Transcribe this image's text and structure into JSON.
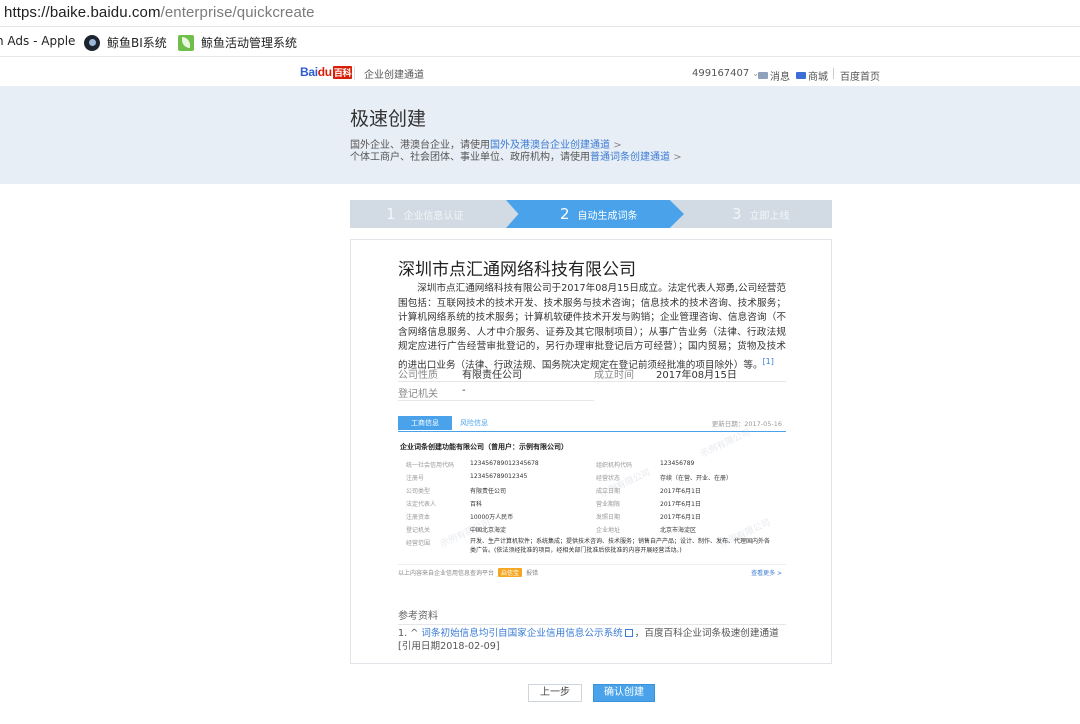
{
  "browser": {
    "url_host": "https://baike.baidu.com",
    "url_path": "/enterprise/quickcreate",
    "bookmarks": [
      {
        "label": "n Ads - Apple"
      },
      {
        "label": "鲸鱼BI系统"
      },
      {
        "label": "鲸鱼活动管理系统"
      }
    ]
  },
  "header": {
    "logo_bai": "Bai",
    "logo_du": "du",
    "logo_baike": "百科",
    "channel": "企业创建通道",
    "user": "499167407",
    "messages": "消息",
    "mall": "商城",
    "home": "百度首页"
  },
  "banner": {
    "title": "极速创建",
    "notice1_prefix": "国外企业、港澳台企业，请使用",
    "notice1_link": "国外及港澳台企业创建通道",
    "notice2_prefix": "个体工商户、社会团体、事业单位、政府机构，请使用",
    "notice2_link": "普通词条创建通道",
    "arrow": ">"
  },
  "steps": [
    {
      "num": "1",
      "label": "企业信息认证"
    },
    {
      "num": "2",
      "label": "自动生成词条"
    },
    {
      "num": "3",
      "label": "立即上线"
    }
  ],
  "card": {
    "company_name": "深圳市点汇通网络科技有限公司",
    "description": "深圳市点汇通网络科技有限公司于2017年08月15日成立。法定代表人郑勇,公司经营范围包括：互联网技术的技术开发、技术服务与技术咨询；信息技术的技术咨询、技术服务；计算机网络系统的技术服务；计算机软硬件技术开发与购销；企业管理咨询、信息咨询（不含网络信息服务、人才中介服务、证券及其它限制项目）；从事广告业务（法律、行政法规规定应进行广告经营审批登记的，另行办理审批登记后方可经营）；国内贸易；货物及技术的进出口业务（法律、行政法规、国务院决定规定在登记前须经批准的项目除外）等。",
    "desc_ref": "[1]",
    "company_type_label": "公司性质",
    "company_type": "有限责任公司",
    "founded_label": "成立时间",
    "founded": "2017年08月15日",
    "authority_label": "登记机关",
    "authority": "-"
  },
  "embed": {
    "tab_active": "工商信息",
    "tab_inactive": "风险信息",
    "updated": "更新日期：2017-05-16",
    "entity": "企业词条创建功能有限公司（曾用户：示例有限公司）",
    "left_labels": [
      "统一社会信用代码",
      "注册号",
      "公司类型",
      "法定代表人",
      "注册资本",
      "登记机关",
      "经营范围"
    ],
    "left_values": [
      "123456789012345678",
      "123456789012345",
      "有限责任公司",
      "百科",
      "10000万人民币",
      "中国北京海淀"
    ],
    "right_labels": [
      "组织机构代码",
      "经营状态",
      "成立日期",
      "营业期限",
      "发照日期",
      "企业地址"
    ],
    "right_values": [
      "123456789",
      "存续（在营、开业、在册）",
      "2017年6月1日",
      "2017年6月1日",
      "2017年6月1日",
      "北京市海淀区"
    ],
    "scope": "开发、生产计算机软件；系统集成；提供技术咨询、技术服务；销售自产产品；设计、制作、发布、代理国内外各类广告。(依法须经批准的项目，经相关部门批准后依批准的内容开展经营活动。)",
    "foot_left": "以上内容来自企业信用信息查询平台",
    "foot_badge": "启信宝",
    "foot_report": "报错",
    "foot_right": "查看更多 >",
    "watermark": "示例有限公司"
  },
  "references": {
    "title": "参考资料",
    "item_prefix": "1. ^ ",
    "item_link": "词条初始信息均引自国家企业信用信息公示系统",
    "item_suffix": "，百度百科企业词条极速创建通道[引用日期2018-02-09]"
  },
  "buttons": {
    "prev": "上一步",
    "confirm": "确认创建"
  }
}
